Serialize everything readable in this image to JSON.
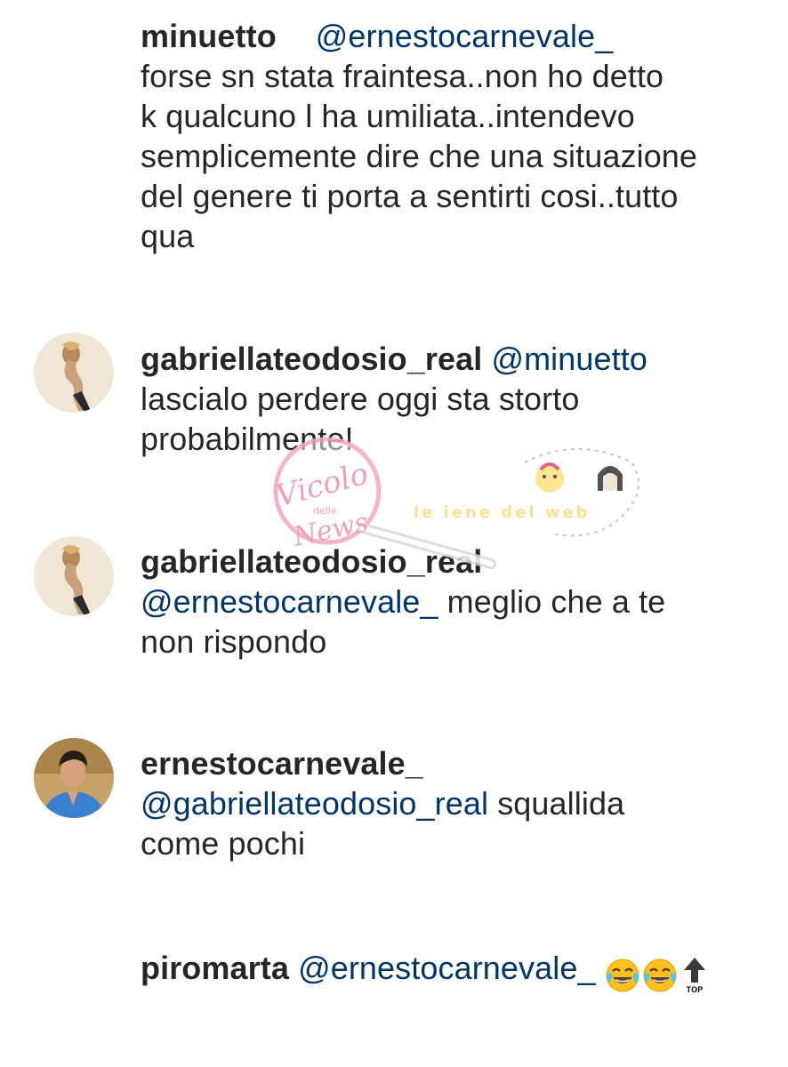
{
  "comments": [
    {
      "username": "minuetto",
      "mention": "@ernestocarnevale_",
      "lines": [
        "forse sn stata fraintesa..non ho detto",
        "k qualcuno l ha umiliata..intendevo",
        "semplicemente dire che una situazione",
        "del genere ti porta a sentirti cosi..tutto",
        "qua"
      ]
    },
    {
      "username": "gabriellateodosio_real",
      "mention": "@minuetto",
      "lines": [
        "lascialo perdere oggi sta storto",
        "probabilmente!"
      ],
      "avatar": "woman-photo-avatar"
    },
    {
      "username": "gabriellateodosio_real",
      "mention": "@ernestocarnevale_",
      "after_mention": "meglio che a te",
      "lines": [
        "non rispondo"
      ],
      "avatar": "woman-photo-avatar"
    },
    {
      "username": "ernestocarnevale_",
      "mention": "@gabriellateodosio_real",
      "after_mention": "squallida",
      "lines": [
        "come pochi"
      ],
      "avatar": "man-photo-avatar"
    },
    {
      "username": "piromarta",
      "mention": "@ernestocarnevale_",
      "emojis": [
        "face-with-tears-of-joy-icon",
        "face-with-tears-of-joy-icon",
        "top-arrow-icon"
      ]
    }
  ],
  "watermark": {
    "logo_text": "Vicolo delle News",
    "tagline": "le iene del web"
  },
  "colors": {
    "text": "#262626",
    "mention": "#003569",
    "background": "#ffffff"
  }
}
